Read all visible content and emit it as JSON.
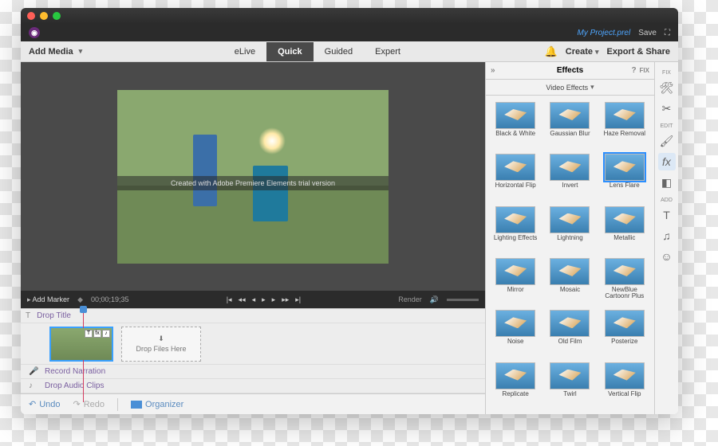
{
  "titlebar": {},
  "topstrip": {
    "project": "My Project.prel",
    "save": "Save"
  },
  "tabbar": {
    "add_media": "Add Media",
    "modes": [
      "eLive",
      "Quick",
      "Guided",
      "Expert"
    ],
    "active_mode": "Quick",
    "create": "Create",
    "export": "Export & Share"
  },
  "preview": {
    "watermark": "Created with  Adobe Premiere Elements  trial version"
  },
  "transport": {
    "add_marker": "Add Marker",
    "timecode": "00;00;19;35",
    "render": "Render"
  },
  "timeline": {
    "title_track": "Drop Title",
    "drop_files": "Drop Files Here",
    "narration": "Record Narration",
    "audio": "Drop Audio Clips"
  },
  "bottombar": {
    "undo": "Undo",
    "redo": "Redo",
    "organizer": "Organizer"
  },
  "panel": {
    "title": "Effects",
    "fix": "FIX",
    "dropdown": "Video Effects",
    "effects": [
      "Black & White",
      "Gaussian Blur",
      "Haze Removal",
      "Horizontal Flip",
      "Invert",
      "Lens Flare",
      "Lighting Effects",
      "Lightning",
      "Metallic",
      "Mirror",
      "Mosaic",
      "NewBlue Cartoonr Plus",
      "Noise",
      "Old Film",
      "Posterize",
      "Replicate",
      "Twirl",
      "Vertical Flip"
    ],
    "selected": "Lens Flare"
  },
  "rail": {
    "sections": [
      "FIX",
      "EDIT",
      "ADD"
    ]
  }
}
